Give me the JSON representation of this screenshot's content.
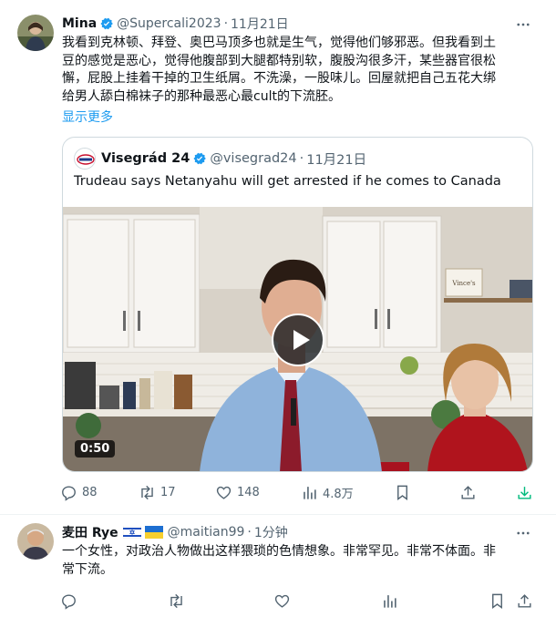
{
  "tweet1": {
    "author_name": "Mina",
    "handle": "@Supercali2023",
    "separator": "·",
    "time": "11月21日",
    "text_lines": [
      "我看到克林顿、拜登、奥巴马顶多也就是生气，觉得他们够邪恶。但我看到土",
      "豆的感觉是恶心，觉得他腹部到大腿都特别软，腹股沟很多汗，某些器官很松",
      "懈，屁股上挂着干掉的卫生纸屑。不洗澡，一股味儿。回屋就把自己五花大绑",
      "给男人舔白棉袜子的那种最恶心最cult的下流胚。"
    ],
    "show_more": "显示更多",
    "quote": {
      "author_name": "Visegrád 24",
      "handle": "@visegrad24",
      "separator": "·",
      "time": "11月21日",
      "text": "Trudeau says Netanyahu will get arrested if he comes to Canada",
      "video_duration": "0:50",
      "sign_text": "Vince's"
    },
    "actions": {
      "replies": "88",
      "retweets": "17",
      "likes": "148",
      "views": "4.8万"
    }
  },
  "tweet2": {
    "author_name": "麦田 Rye",
    "handle": "@maitian99",
    "separator": "·",
    "time": "1分钟",
    "text_lines": [
      "一个女性，对政治人物做出这样猥琐的色情想象。非常罕见。非常不体面。非",
      "常下流。"
    ]
  },
  "colors": {
    "accent": "#1d9bf0",
    "secondary_text": "#536471",
    "border": "#cfd9de"
  },
  "icons": [
    "verified-badge-icon",
    "more-icon",
    "reply-icon",
    "retweet-icon",
    "like-icon",
    "views-icon",
    "bookmark-icon",
    "share-icon",
    "download-icon",
    "play-icon",
    "israel-flag-icon",
    "ukraine-flag-icon"
  ]
}
